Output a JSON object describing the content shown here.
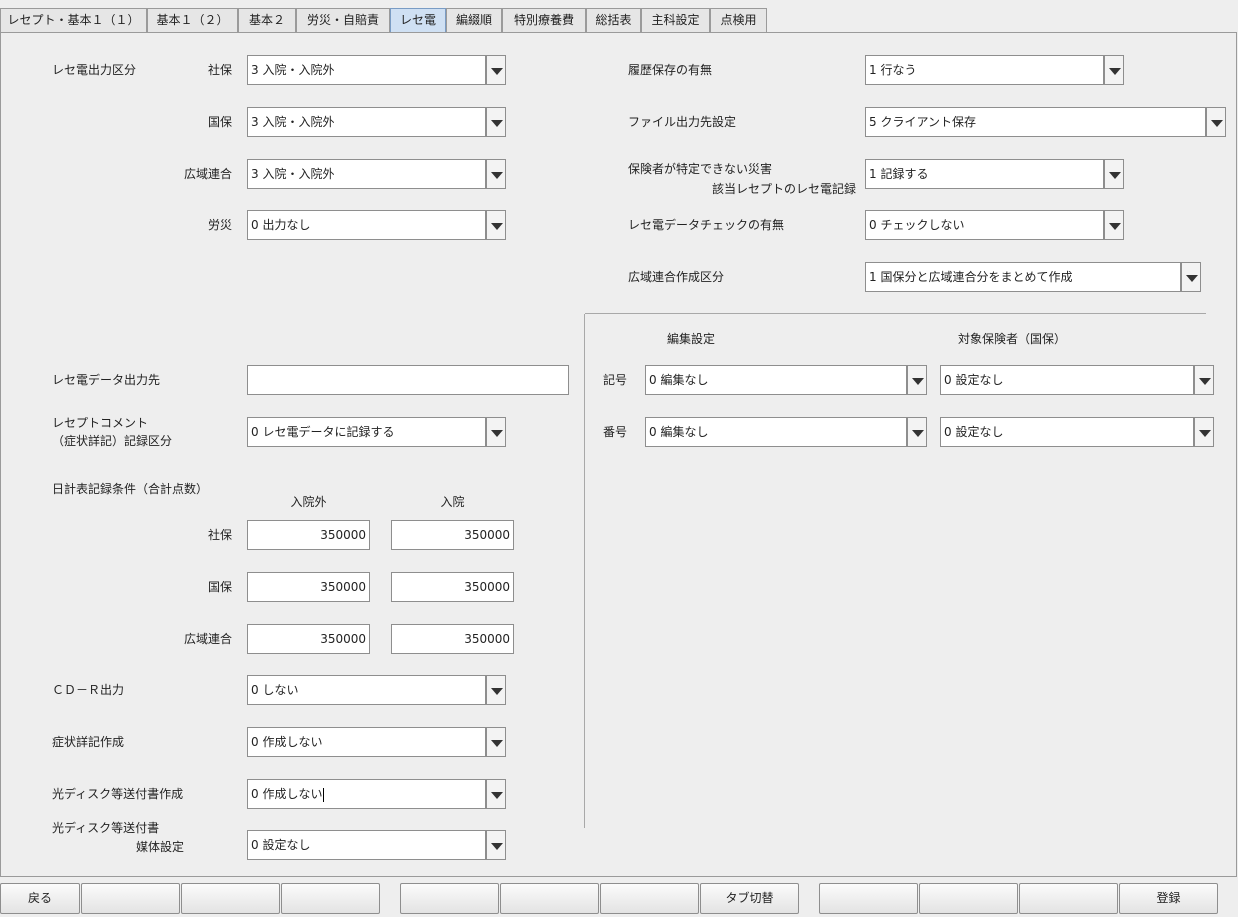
{
  "tabs": [
    {
      "label": "レセプト・基本１（１）",
      "active": false
    },
    {
      "label": "基本１（２）",
      "active": false
    },
    {
      "label": "基本２",
      "active": false
    },
    {
      "label": "労災・自賠責",
      "active": false
    },
    {
      "label": "レセ電",
      "active": true
    },
    {
      "label": "編綴順",
      "active": false
    },
    {
      "label": "特別療養費",
      "active": false
    },
    {
      "label": "総括表",
      "active": false
    },
    {
      "label": "主科設定",
      "active": false
    },
    {
      "label": "点検用",
      "active": false
    }
  ],
  "output_section": {
    "title": "レセ電出力区分",
    "shaho": {
      "label": "社保",
      "value": "3 入院・入院外"
    },
    "kokuho": {
      "label": "国保",
      "value": "3 入院・入院外"
    },
    "kouiki": {
      "label": "広域連合",
      "value": "3 入院・入院外"
    },
    "rosai": {
      "label": "労災",
      "value": "0 出力なし"
    }
  },
  "right_settings": {
    "history": {
      "label": "履歴保存の有無",
      "value": "1 行なう"
    },
    "file_output": {
      "label": "ファイル出力先設定",
      "value": "5 クライアント保存"
    },
    "disaster": {
      "label_line1": "保険者が特定できない災害",
      "label_line2": "該当レセプトのレセ電記録",
      "value": "1 記録する"
    },
    "data_check": {
      "label": "レセ電データチェックの有無",
      "value": "0 チェックしない"
    },
    "kouiki_create": {
      "label": "広域連合作成区分",
      "value": "1 国保分と広域連合分をまとめて作成"
    }
  },
  "edit_section": {
    "edit_header": "編集設定",
    "target_header": "対象保険者（国保）",
    "kigou": {
      "label": "記号",
      "edit": "0 編集なし",
      "target": "0 設定なし"
    },
    "bangou": {
      "label": "番号",
      "edit": "0 編集なし",
      "target": "0 設定なし"
    }
  },
  "data_output_dest": {
    "label": "レセ電データ出力先",
    "value": ""
  },
  "receipt_comment": {
    "label_line1": "レセプトコメント",
    "label_line2": "（症状詳記）記録区分",
    "value": "0 レセ電データに記録する"
  },
  "daily_table": {
    "title": "日計表記録条件（合計点数）",
    "col_outpatient": "入院外",
    "col_inpatient": "入院",
    "rows": [
      {
        "label": "社保",
        "outpatient": "350000",
        "inpatient": "350000"
      },
      {
        "label": "国保",
        "outpatient": "350000",
        "inpatient": "350000"
      },
      {
        "label": "広域連合",
        "outpatient": "350000",
        "inpatient": "350000"
      }
    ]
  },
  "cdr_output": {
    "label": "ＣＤ－Ｒ出力",
    "value": "0 しない"
  },
  "symptom_detail": {
    "label": "症状詳記作成",
    "value": "0 作成しない"
  },
  "optical_disk_doc": {
    "label": "光ディスク等送付書作成",
    "value": "0 作成しない"
  },
  "optical_disk_media": {
    "label_line1": "光ディスク等送付書",
    "label_line2": "媒体設定",
    "value": "0 設定なし"
  },
  "function_keys": [
    "戻る",
    "",
    "",
    "",
    "",
    "",
    "",
    "タブ切替",
    "",
    "",
    "",
    "登録"
  ]
}
